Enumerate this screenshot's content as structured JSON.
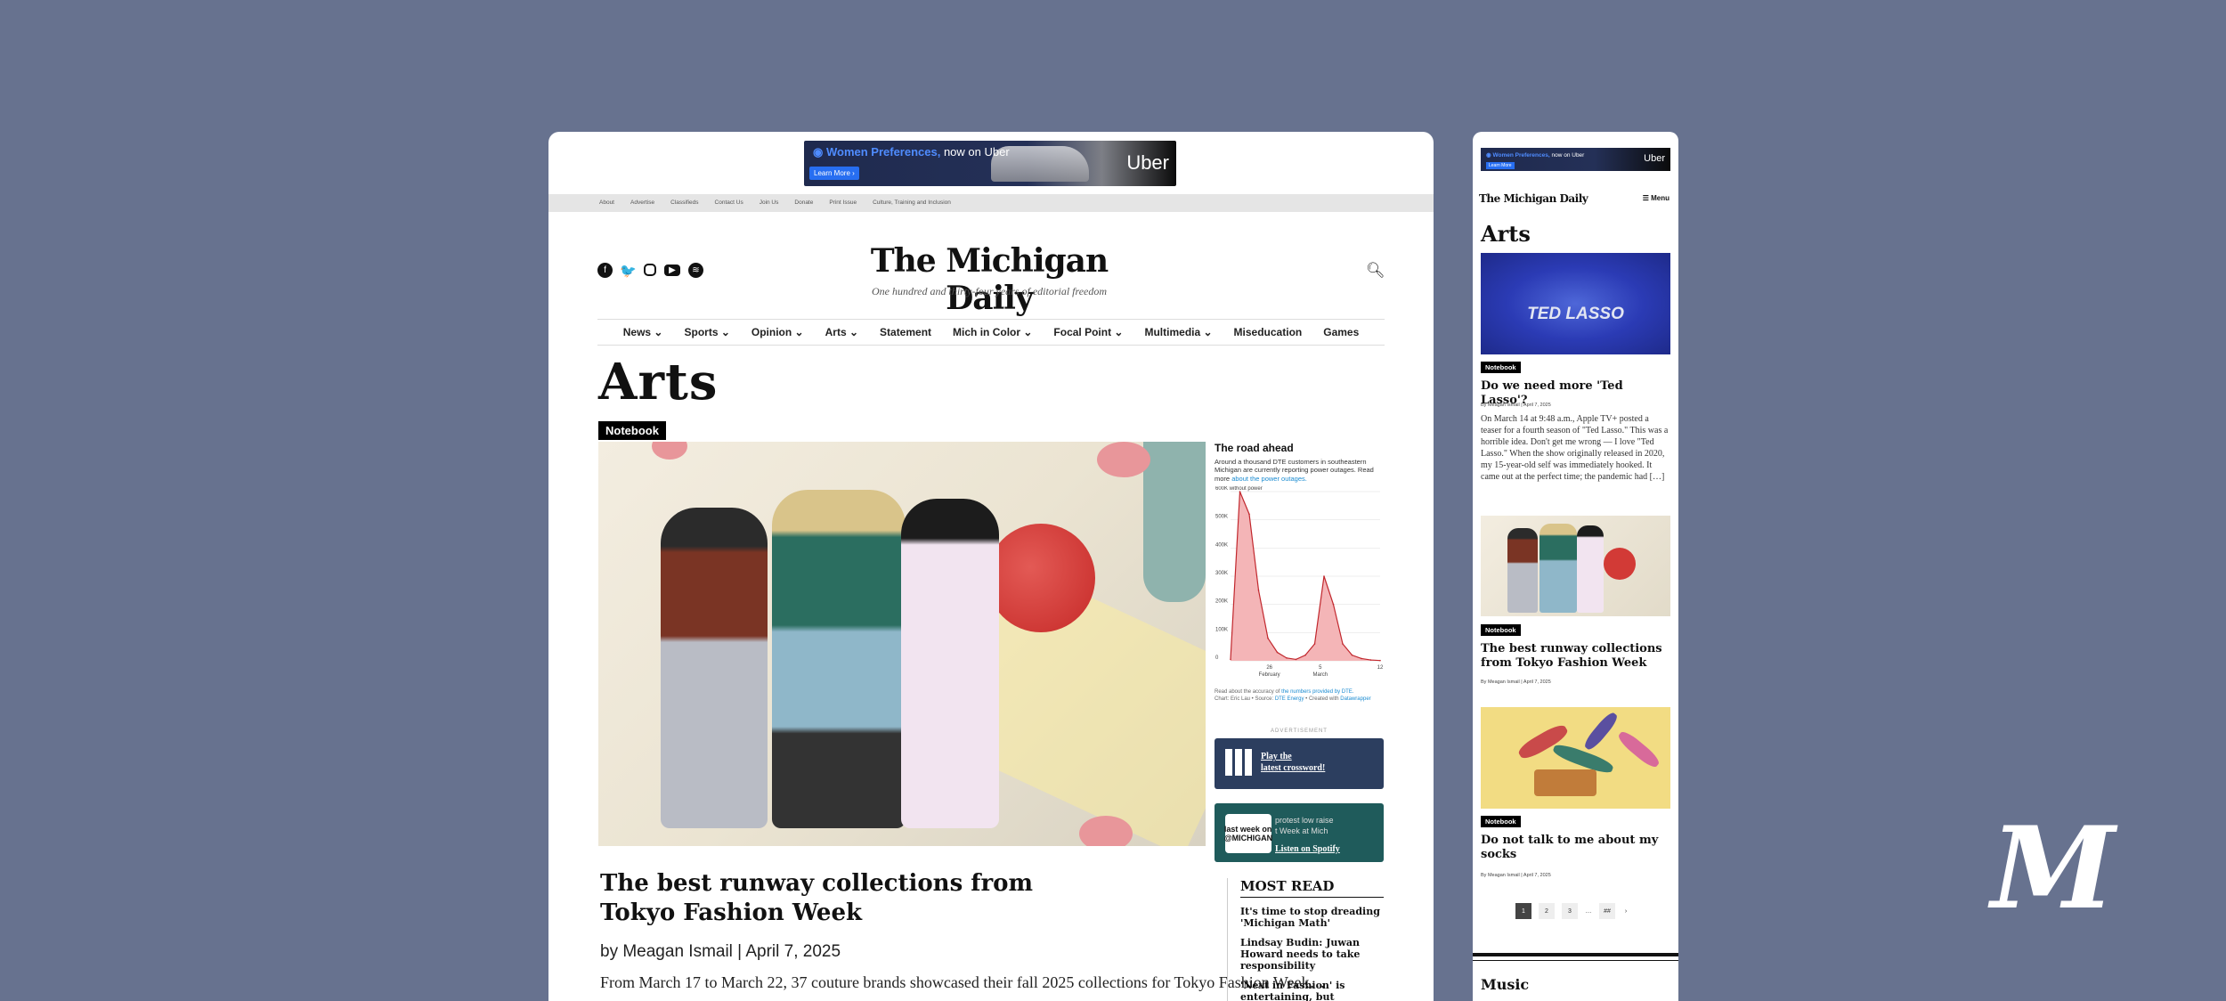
{
  "ad": {
    "headline_brand": "Women Preferences,",
    "headline_rest": " now on Uber",
    "cta": "Learn More",
    "brand": "Uber"
  },
  "topbar": {
    "links": [
      "About",
      "Advertise",
      "Classifieds",
      "Contact Us",
      "Join Us",
      "Donate",
      "Print Issue",
      "Culture, Training and Inclusion"
    ]
  },
  "header": {
    "logo": "The Michigan Daily",
    "tagline": "One hundred and thirty-four years of editorial freedom"
  },
  "nav": {
    "items": [
      "News ⌄",
      "Sports ⌄",
      "Opinion ⌄",
      "Arts ⌄",
      "Statement",
      "Mich in Color ⌄",
      "Focal Point ⌄",
      "Multimedia ⌄",
      "Miseducation",
      "Games"
    ]
  },
  "page": {
    "title": "Arts"
  },
  "featured": {
    "badge": "Notebook",
    "headline": "The best runway collections from Tokyo Fashion Week",
    "byline": "by Meagan Ismail | April 7, 2025",
    "excerpt": "From March 17 to March 22, 37 couture brands showcased their fall 2025 collections for Tokyo Fashion Week…"
  },
  "chart_widget": {
    "title": "The road ahead",
    "desc": "Around a thousand DTE customers in southeastern Michigan are currently reporting power outages. Read more",
    "desc_link": "about the power outages.",
    "foot_prefix": "Read about the accuracy of",
    "foot_link": "the numbers provided by DTE.",
    "source_prefix": "Chart: Eric Lau • Source:",
    "source_link": "DTE Energy",
    "credit_prefix": "• Created with",
    "credit_link": "Datawrapper"
  },
  "chart_data": {
    "type": "area",
    "title": "The road ahead",
    "ylabel": "without power",
    "y_ticks": [
      "0",
      "100K",
      "200K",
      "300K",
      "400K",
      "500K",
      "600K"
    ],
    "x_ticks": [
      "26",
      "February",
      "5",
      "March",
      "12"
    ],
    "ylim": [
      0,
      600000
    ],
    "x": [
      0,
      1,
      2,
      3,
      4,
      5,
      6,
      7,
      8,
      9,
      10,
      11,
      12,
      13,
      14,
      15,
      16
    ],
    "values": [
      5000,
      600000,
      520000,
      250000,
      80000,
      30000,
      10000,
      5000,
      20000,
      60000,
      300000,
      200000,
      60000,
      20000,
      8000,
      3000,
      1000
    ],
    "color": "#c1272d",
    "fill": "#f4b5b7"
  },
  "promos": {
    "advert_label": "ADVERTISEMENT",
    "crossword_line1": "Play the",
    "crossword_line2": "latest crossword!",
    "spotify_art": "last week on @MICHIGAN",
    "spotify_t1": "protest low raise",
    "spotify_t2": "t Week at Mich",
    "spotify_cta": "Listen on Spotify"
  },
  "most_read": {
    "title": "MOST READ",
    "items": [
      "It's time to stop dreading 'Michigan Math'",
      "Lindsay Budin: Juwan Howard needs to take responsibility",
      "'Next in Fashion' is entertaining, but problematic"
    ]
  },
  "mobile": {
    "ad_brand": "Women Preferences,",
    "ad_rest": " now on Uber",
    "ad_cta": "Learn More",
    "ad_logo": "Uber",
    "logo": "The Michigan Daily",
    "menu": "☰ Menu",
    "title": "Arts",
    "article1": {
      "image_text": "TED LASSO",
      "badge": "Notebook",
      "headline": "Do we need more 'Ted Lasso'?",
      "byline": "By Meagan Ismail | April 7, 2025",
      "excerpt": "On March 14 at 9:48 a.m., Apple TV+ posted a teaser for a fourth season of \"Ted Lasso.\" This was a horrible idea. Don't get me wrong — I love \"Ted Lasso.\" When the show originally released in 2020, my 15-year-old self was immediately hooked. It came out at the perfect time; the pandemic had […]"
    },
    "article2": {
      "badge": "Notebook",
      "headline": "The best runway collections from Tokyo Fashion Week",
      "byline": "By Meagan Ismail | April 7, 2025"
    },
    "article3": {
      "badge": "Notebook",
      "headline": "Do not talk to me about my socks",
      "byline": "By Meagan Ismail | April 7, 2025"
    },
    "pager": [
      "1",
      "2",
      "3",
      "…",
      "##",
      "›"
    ],
    "music": "Music"
  },
  "corner_logo": "M"
}
